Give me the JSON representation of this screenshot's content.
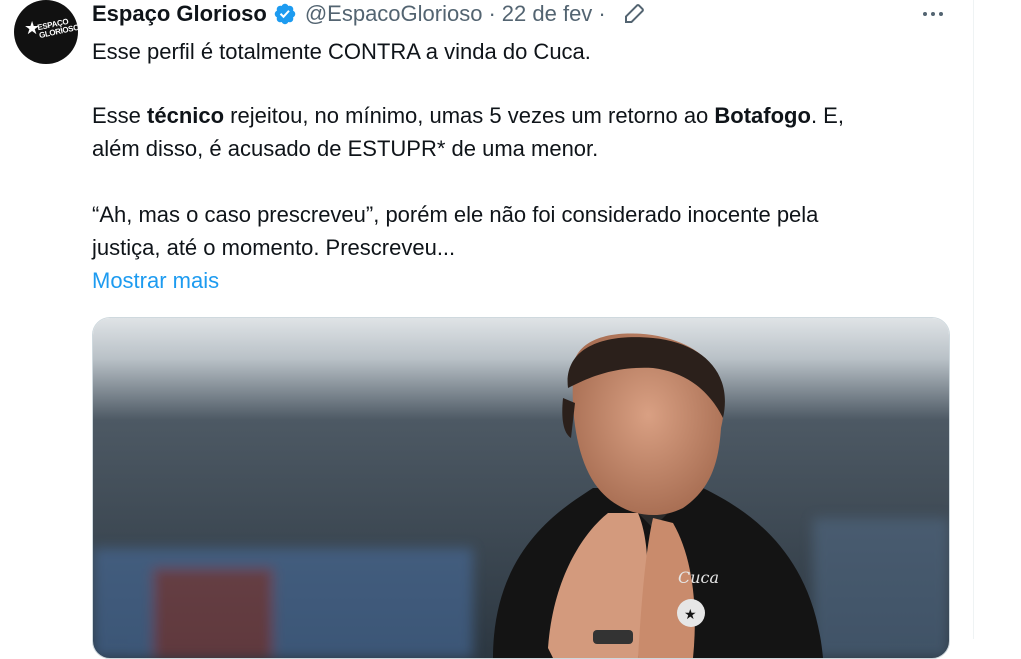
{
  "tweet": {
    "author": {
      "display_name": "Espaço Glorioso",
      "handle": "@EspacoGlorioso",
      "avatar_text": "ESPAÇO GLORIOSO",
      "verified": true
    },
    "separator": "·",
    "date": "22 de fev",
    "lines": {
      "l1": "Esse perfil é totalmente CONTRA a vinda do Cuca.",
      "l2_a": "Esse ",
      "l2_b": "técnico",
      "l2_c": " rejeitou, no mínimo, umas 5 vezes um retorno ao ",
      "l2_d": "Botafogo",
      "l2_e": ". E,",
      "l3": "além disso, é acusado de ESTUPR* de uma menor.",
      "l4": "“Ah, mas o caso prescreveu”, porém ele não foi considerado inocente pela",
      "l5": "justiça, até o momento. Prescreveu..."
    },
    "show_more": "Mostrar mais",
    "media": {
      "shirt_signature": "Cuca",
      "colors": {
        "shirt": "#141414",
        "skin": "#c98b6c",
        "background": "#2f3a44"
      }
    }
  },
  "icons": {
    "verified": "verified-badge-icon",
    "edit": "edit-pencil-icon",
    "more": "more-horizontal-icon"
  },
  "colors": {
    "link": "#1d9bf0",
    "secondary": "#536471",
    "text": "#0f1419",
    "verified": "#1d9bf0"
  }
}
